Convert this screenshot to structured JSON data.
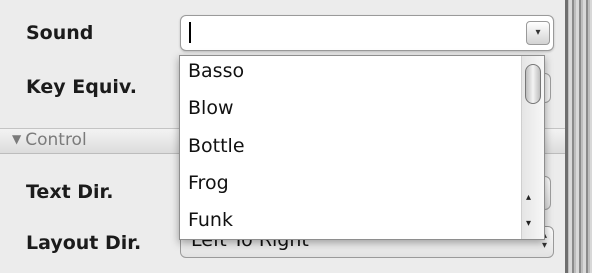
{
  "labels": {
    "sound": "Sound",
    "key_equiv": "Key Equiv.",
    "text_dir": "Text Dir.",
    "layout_dir": "Layout Dir."
  },
  "section": {
    "arrow": "▼",
    "title": "Control"
  },
  "sound_combo": {
    "value": "",
    "button_icon": "chevron-down-icon",
    "button_glyph": "▾"
  },
  "dropdown": {
    "options": [
      "Basso",
      "Blow",
      "Bottle",
      "Frog",
      "Funk"
    ],
    "scroll_up_glyph": "▴",
    "scroll_down_glyph": "▾"
  },
  "layout_popup": {
    "value": "Left To Right",
    "glyph_up": "▴",
    "glyph_down": "▾"
  }
}
